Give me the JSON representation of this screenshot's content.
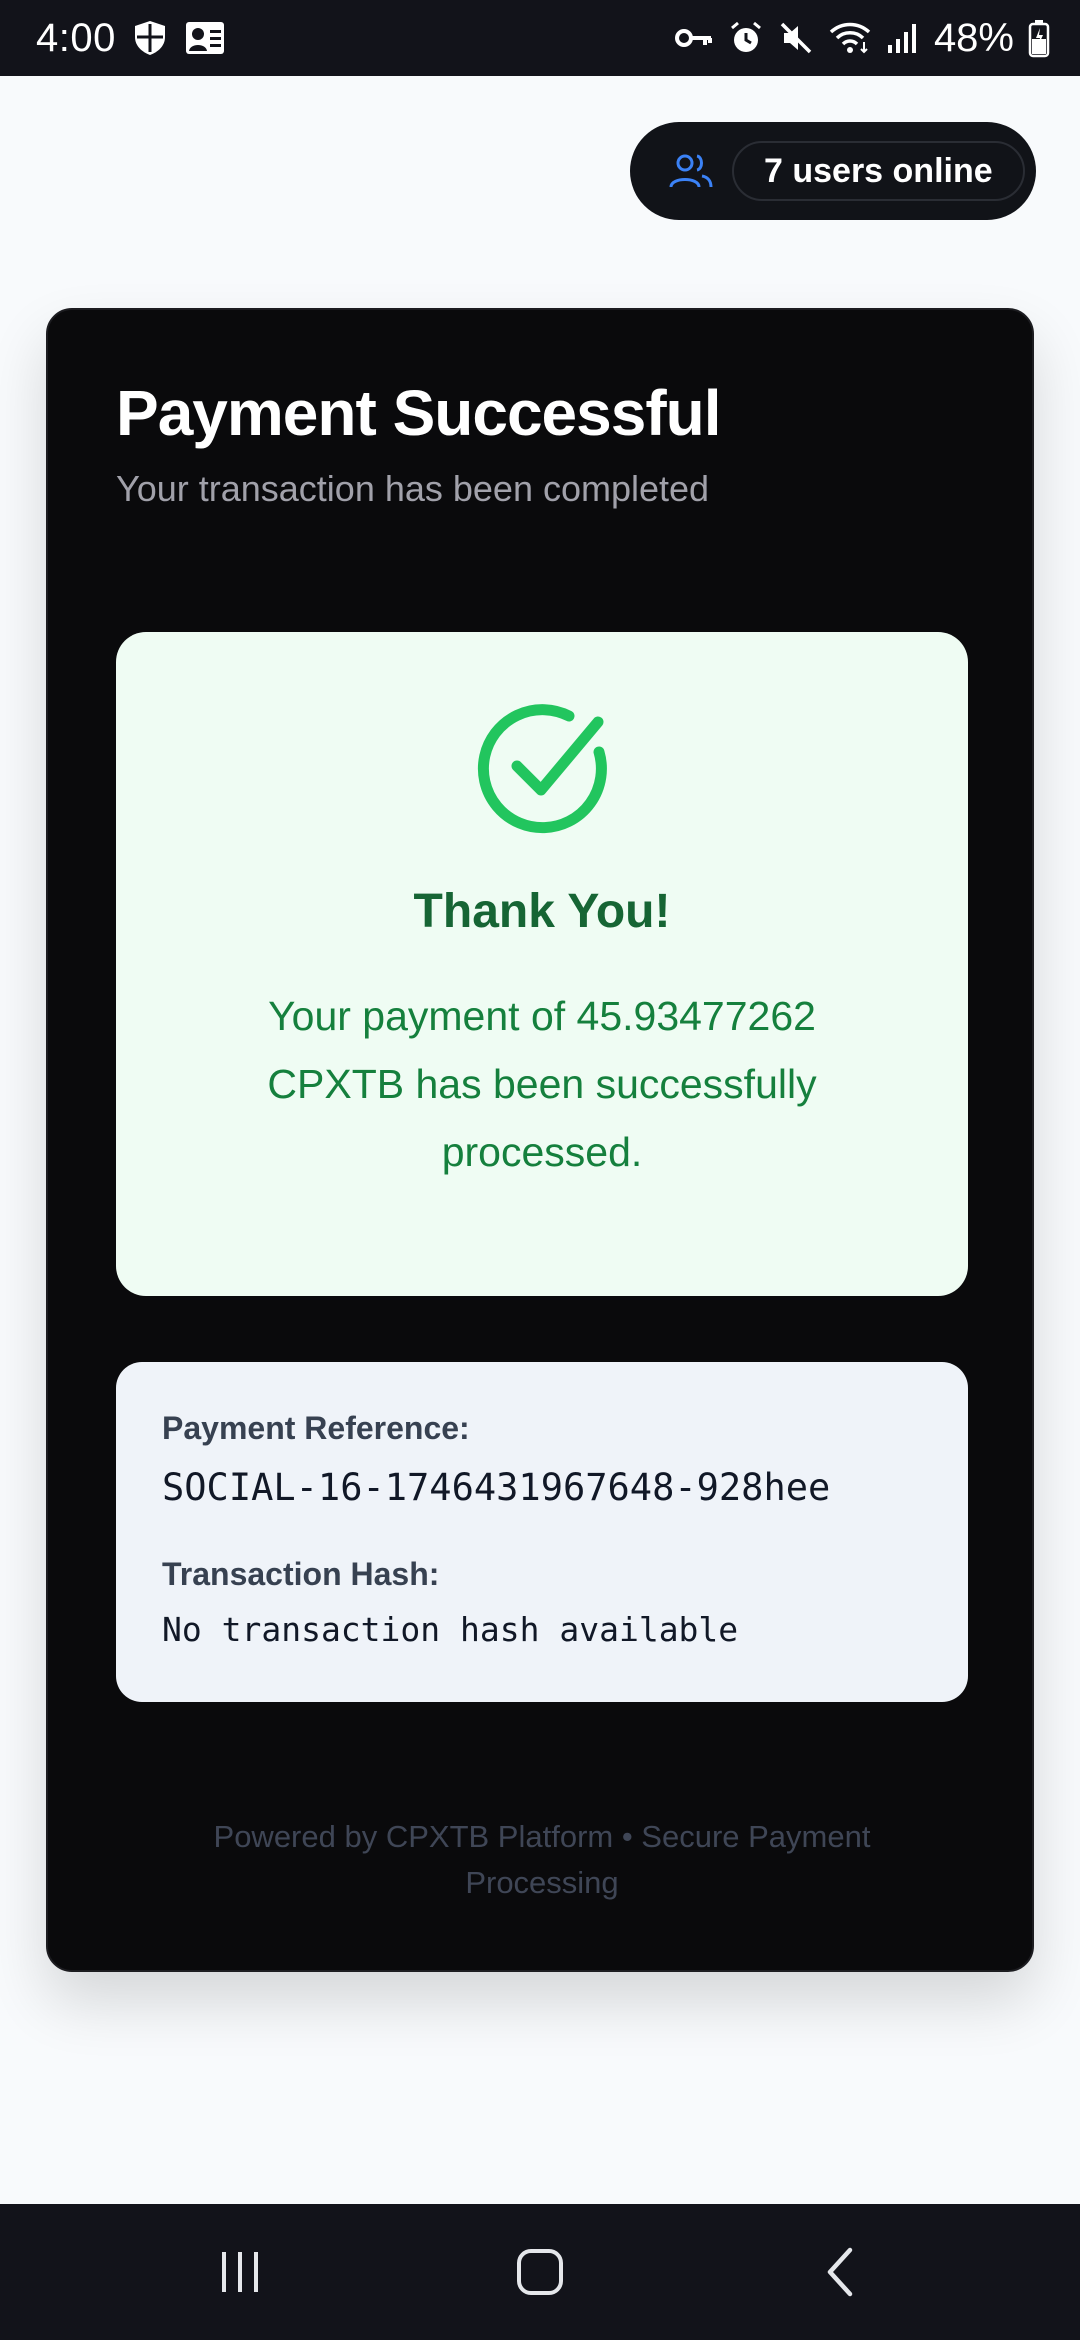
{
  "status_bar": {
    "time": "4:00",
    "battery": "48%",
    "left_icons": [
      "shield-icon",
      "profile-card-icon"
    ],
    "right_icons": [
      "vpn-key-icon",
      "alarm-icon",
      "mute-icon",
      "wifi-icon",
      "signal-icon",
      "battery-icon"
    ]
  },
  "presence": {
    "icon": "users-icon",
    "label": "7 users online",
    "icon_color": "#3b82f6"
  },
  "card": {
    "title": "Payment Successful",
    "subtitle": "Your transaction has been completed"
  },
  "success": {
    "icon": "check-circle-icon",
    "icon_color": "#22c55e",
    "heading": "Thank You!",
    "message": "Your payment of 45.93477262 CPXTB has been successfully processed."
  },
  "details": {
    "reference_label": "Payment Reference:",
    "reference_value": "SOCIAL-16-1746431967648-928hee",
    "hash_label": "Transaction Hash:",
    "hash_value": "No transaction hash available"
  },
  "footer": {
    "text": "Powered by CPXTB Platform • Secure Payment Processing"
  },
  "nav_bar": {
    "buttons": [
      "recents-icon",
      "home-icon",
      "back-icon"
    ]
  }
}
